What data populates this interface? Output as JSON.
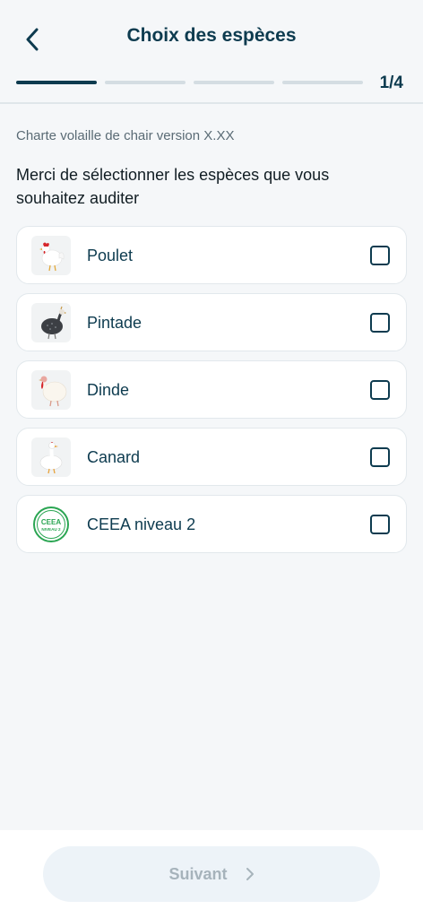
{
  "header": {
    "title": "Choix des espèces",
    "step_indicator": "1/4",
    "progress": {
      "current_step": 1,
      "total_steps": 4
    }
  },
  "charter_label": "Charte volaille de chair version X.XX",
  "prompt": "Merci de sélectionner les espèces que vous souhaitez auditer",
  "species": [
    {
      "label": "Poulet",
      "icon": "chicken-icon",
      "checked": false
    },
    {
      "label": "Pintade",
      "icon": "guinea-fowl-icon",
      "checked": false
    },
    {
      "label": "Dinde",
      "icon": "turkey-icon",
      "checked": false
    },
    {
      "label": "Canard",
      "icon": "duck-icon",
      "checked": false
    },
    {
      "label": "CEEA niveau 2",
      "icon": "ceea-logo-icon",
      "checked": false
    }
  ],
  "ceea_logo": {
    "line1": "CEEA",
    "line2": "NIVEAU 2"
  },
  "footer": {
    "next_label": "Suivant",
    "next_enabled": false
  },
  "colors": {
    "primary": "#0d3b4f",
    "background": "#f5f7f9",
    "disabled_button_bg": "#edf3f8",
    "disabled_button_text": "#a6b3bb",
    "ceea_green": "#2aa552"
  }
}
